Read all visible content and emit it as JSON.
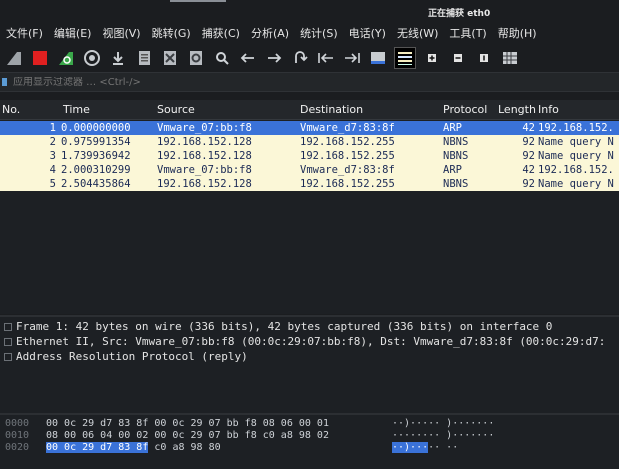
{
  "window": {
    "title": "正在捕获 eth0"
  },
  "menu": [
    "文件(F)",
    "编辑(E)",
    "视图(V)",
    "跳转(G)",
    "捕获(C)",
    "分析(A)",
    "统计(S)",
    "电话(Y)",
    "无线(W)",
    "工具(T)",
    "帮助(H)"
  ],
  "toolbar": {
    "icons": [
      "shark-fin-icon",
      "stop-capture-icon",
      "restart-capture-icon",
      "capture-options-icon",
      "open-file-icon",
      "save-file-icon",
      "close-file-icon",
      "reload-file-icon",
      "find-packet-icon",
      "go-back-icon",
      "go-forward-icon",
      "go-to-packet-icon",
      "go-first-icon",
      "go-last-icon",
      "autoscroll-icon",
      "colorize-icon",
      "zoom-in-icon",
      "zoom-out-icon",
      "normal-size-icon",
      "resize-columns-icon"
    ]
  },
  "filter": {
    "placeholder": "应用显示过滤器 … <Ctrl-/>"
  },
  "packet_list": {
    "columns": [
      "No.",
      "Time",
      "Source",
      "Destination",
      "Protocol",
      "Length",
      "Info"
    ],
    "rows": [
      {
        "no": "1",
        "time": "0.000000000",
        "source": "Vmware_07:bb:f8",
        "destination": "Vmware_d7:83:8f",
        "protocol": "ARP",
        "length": "42",
        "info": "192.168.152.",
        "selected": true
      },
      {
        "no": "2",
        "time": "0.975991354",
        "source": "192.168.152.128",
        "destination": "192.168.152.255",
        "protocol": "NBNS",
        "length": "92",
        "info": "Name query N",
        "selected": false
      },
      {
        "no": "3",
        "time": "1.739936942",
        "source": "192.168.152.128",
        "destination": "192.168.152.255",
        "protocol": "NBNS",
        "length": "92",
        "info": "Name query N",
        "selected": false
      },
      {
        "no": "4",
        "time": "2.000310299",
        "source": "Vmware_07:bb:f8",
        "destination": "Vmware_d7:83:8f",
        "protocol": "ARP",
        "length": "42",
        "info": "192.168.152.",
        "selected": false
      },
      {
        "no": "5",
        "time": "2.504435864",
        "source": "192.168.152.128",
        "destination": "192.168.152.255",
        "protocol": "NBNS",
        "length": "92",
        "info": "Name query N",
        "selected": false
      }
    ]
  },
  "details": [
    "Frame 1: 42 bytes on wire (336 bits), 42 bytes captured (336 bits) on interface 0",
    "Ethernet II, Src: Vmware_07:bb:f8 (00:0c:29:07:bb:f8), Dst: Vmware_d7:83:8f (00:0c:29:d7:",
    "Address Resolution Protocol (reply)"
  ],
  "hex": [
    {
      "offset": "0000",
      "hl": "",
      "bytes": "00 0c 29 d7 83 8f 00 0c  29 07 bb f8 08 06 00 01",
      "ascii_hl": "",
      "ascii": "··)·····  )·······"
    },
    {
      "offset": "0010",
      "hl": "",
      "bytes": "08 00 06 04 00 02 00 0c  29 07 bb f8 c0 a8 98 02",
      "ascii_hl": "",
      "ascii": "········  )·······"
    },
    {
      "offset": "0020",
      "hl": "00 0c 29 d7 83 8f",
      "bytes": " c0 a8  98 80",
      "ascii_hl": "··)···",
      "ascii": "·· ··"
    }
  ]
}
